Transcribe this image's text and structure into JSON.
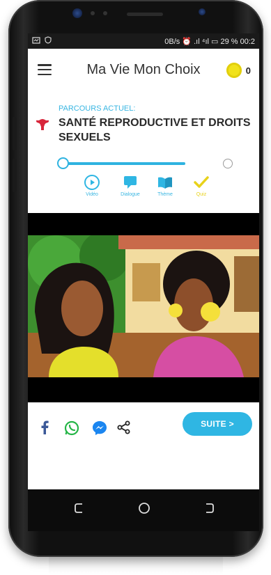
{
  "statusbar": {
    "right_text": "0B/s ⏰ .ıl ⁴ıl ▭ 29 % 00:2"
  },
  "app": {
    "title": "Ma Vie Mon Choix",
    "coin_count": "0"
  },
  "parcours": {
    "label": "PARCOURS ACTUEL:",
    "title": "SANTÉ REPRODUCTIVE ET DROITS SEXUELS"
  },
  "steps": [
    {
      "label": "Vidéo",
      "icon": "play-circle-icon"
    },
    {
      "label": "Dialogue",
      "icon": "chat-bubble-icon"
    },
    {
      "label": "Thème",
      "icon": "book-icon"
    },
    {
      "label": "Quiz",
      "icon": "checkmark-icon"
    }
  ],
  "share": {
    "icons": [
      "facebook-icon",
      "whatsapp-icon",
      "messenger-icon",
      "share-icon"
    ]
  },
  "actions": {
    "suite_label": "SUITE >"
  },
  "colors": {
    "accent": "#2fb6e3",
    "coin": "#f1e21b",
    "quiz": "#e8d21a",
    "uterus": "#d8263b"
  }
}
